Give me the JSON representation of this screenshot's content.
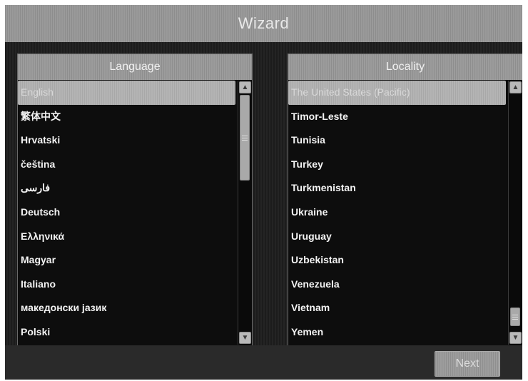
{
  "window": {
    "title": "Wizard"
  },
  "language_panel": {
    "header": "Language",
    "items": [
      {
        "label": "English",
        "selected": true
      },
      {
        "label": "繁体中文",
        "selected": false
      },
      {
        "label": "Hrvatski",
        "selected": false
      },
      {
        "label": "čeština",
        "selected": false
      },
      {
        "label": "فارسی",
        "selected": false
      },
      {
        "label": "Deutsch",
        "selected": false
      },
      {
        "label": "Ελληνικά",
        "selected": false
      },
      {
        "label": "Magyar",
        "selected": false
      },
      {
        "label": "Italiano",
        "selected": false
      },
      {
        "label": "македонски јазик",
        "selected": false
      },
      {
        "label": "Polski",
        "selected": false
      }
    ]
  },
  "locality_panel": {
    "header": "Locality",
    "items": [
      {
        "label": "The United States (Pacific)",
        "selected": true
      },
      {
        "label": "Timor-Leste",
        "selected": false
      },
      {
        "label": "Tunisia",
        "selected": false
      },
      {
        "label": "Turkey",
        "selected": false
      },
      {
        "label": "Turkmenistan",
        "selected": false
      },
      {
        "label": "Ukraine",
        "selected": false
      },
      {
        "label": "Uruguay",
        "selected": false
      },
      {
        "label": "Uzbekistan",
        "selected": false
      },
      {
        "label": "Venezuela",
        "selected": false
      },
      {
        "label": "Vietnam",
        "selected": false
      },
      {
        "label": "Yemen",
        "selected": false
      }
    ]
  },
  "footer": {
    "next_label": "Next"
  },
  "icons": {
    "scroll_up": "chevron-up-icon",
    "scroll_down": "chevron-down-icon"
  }
}
